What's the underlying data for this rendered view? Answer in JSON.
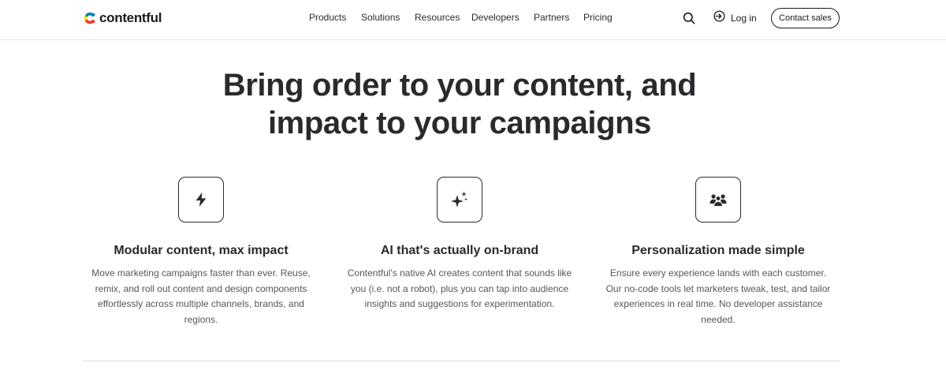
{
  "brand": {
    "name": "contentful",
    "colors": {
      "yellow": "#ffda00",
      "blue": "#0681b6",
      "red": "#ea3a30",
      "dark": "#1a1a1a"
    }
  },
  "nav": {
    "items": [
      "Products",
      "Solutions",
      "Resources",
      "Developers",
      "Partners",
      "Pricing"
    ],
    "search_icon": "search-icon",
    "login_label": "Log in",
    "contact_label": "Contact sales"
  },
  "hero": {
    "title_line1": "Bring order to your content, and",
    "title_line2": "impact to your campaigns"
  },
  "features": [
    {
      "icon": "lightning-bolt-icon",
      "title": "Modular content, max impact",
      "description": "Move marketing campaigns faster than ever. Reuse, remix, and roll out content and design components effortlessly across multiple channels, brands, and regions."
    },
    {
      "icon": "sparkles-icon",
      "title": "AI that's actually on-brand",
      "description": "Contentful's native AI creates content that sounds like you (i.e. not a robot), plus you can tap into audience insights and suggestions for experimentation."
    },
    {
      "icon": "users-group-icon",
      "title": "Personalization made simple",
      "description": "Ensure every experience lands with each customer. Our no-code tools let marketers tweak, test, and tailor experiences in real time. No developer assistance needed."
    }
  ]
}
